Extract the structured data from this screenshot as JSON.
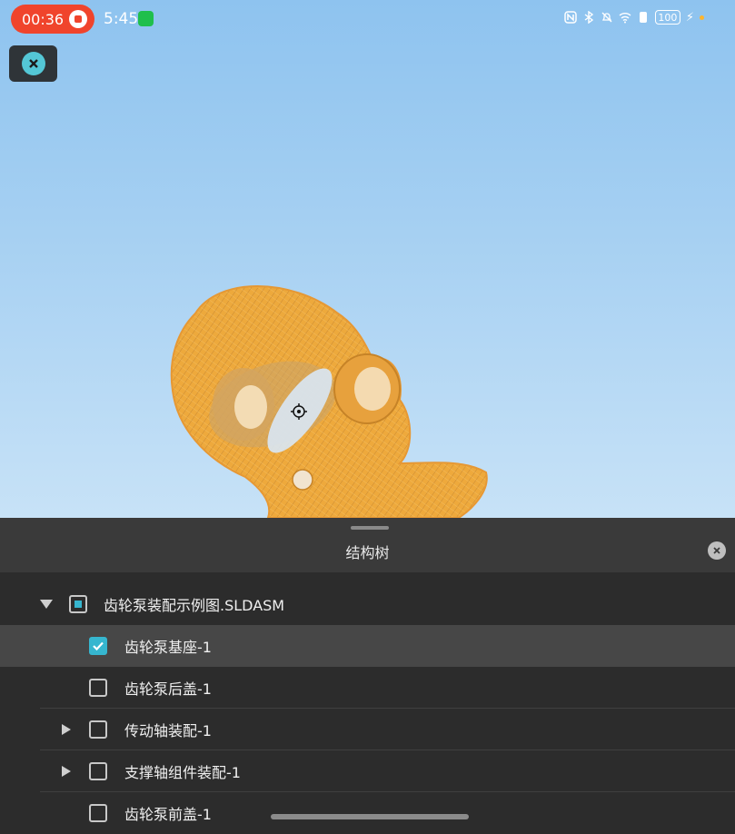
{
  "status_bar": {
    "recording_time": "00:36",
    "clock": "5:45",
    "battery_level": "100",
    "icons": [
      "record-stop-icon",
      "wechat-icon",
      "nfc-icon",
      "bluetooth-icon",
      "silent-icon",
      "wifi-icon",
      "vibrate-icon",
      "battery-icon",
      "charging-icon"
    ]
  },
  "viewport": {
    "close_icon": "close-icon",
    "pivot_icon": "target-icon",
    "model_color": "#f4a92a",
    "background_top": "#8ec3ef",
    "background_bottom": "#c7e2f7"
  },
  "panel": {
    "title": "结构树",
    "close_icon": "close-circle-icon",
    "tree": [
      {
        "label": "齿轮泵装配示例图.SLDASM",
        "expand": "expanded",
        "state": "partial",
        "level": 0,
        "selected": false
      },
      {
        "label": "齿轮泵基座-1",
        "expand": "none",
        "state": "checked",
        "level": 1,
        "selected": true
      },
      {
        "label": "齿轮泵后盖-1",
        "expand": "none",
        "state": "unchecked",
        "level": 1,
        "selected": false
      },
      {
        "label": "传动轴装配-1",
        "expand": "collapsed",
        "state": "unchecked",
        "level": 1,
        "selected": false
      },
      {
        "label": "支撑轴组件装配-1",
        "expand": "collapsed",
        "state": "unchecked",
        "level": 1,
        "selected": false
      },
      {
        "label": "齿轮泵前盖-1",
        "expand": "none",
        "state": "unchecked",
        "level": 1,
        "selected": false
      }
    ]
  }
}
